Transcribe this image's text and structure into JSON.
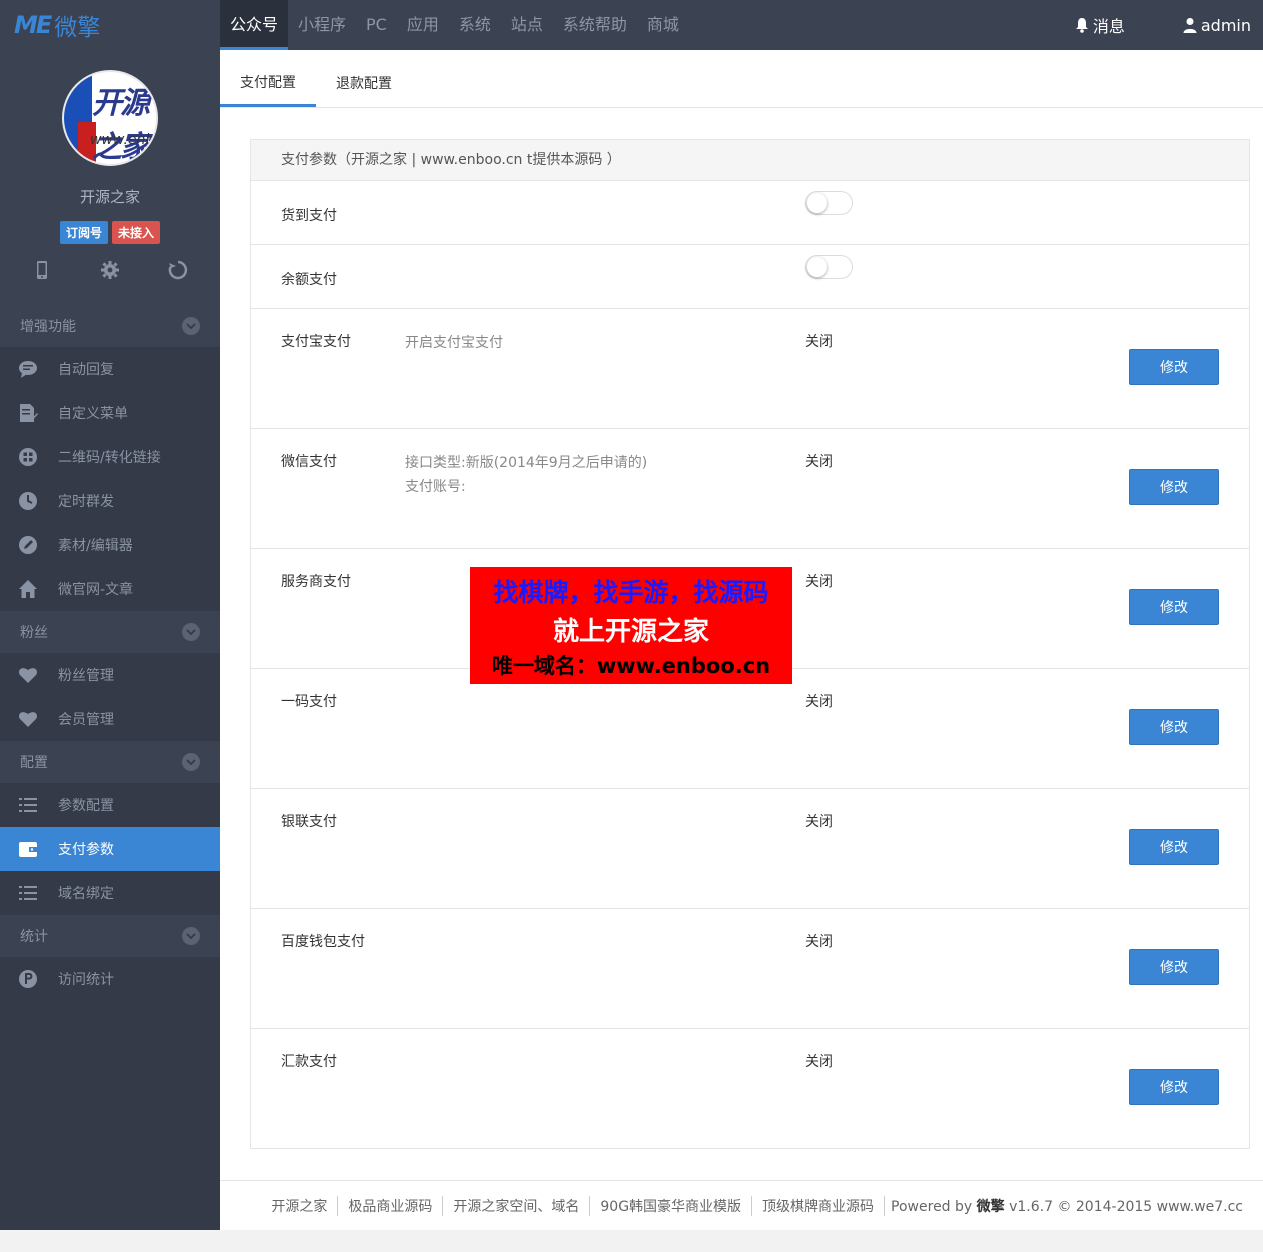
{
  "brand": {
    "logo_me": "ME",
    "logo_text": "微擎"
  },
  "top_nav": [
    "公众号",
    "小程序",
    "PC",
    "应用",
    "系统",
    "站点",
    "系统帮助",
    "商城"
  ],
  "top_right": {
    "messages": "消息",
    "user": "admin"
  },
  "profile": {
    "avatar_text": "开源之家",
    "avatar_url_text": "www.enboo",
    "name": "开源之家",
    "badge_type": "订阅号",
    "badge_status": "未接入"
  },
  "sidebar": {
    "groups": [
      {
        "title": "增强功能",
        "items": [
          "自动回复",
          "自定义菜单",
          "二维码/转化链接",
          "定时群发",
          "素材/编辑器",
          "微官网-文章"
        ]
      },
      {
        "title": "粉丝",
        "items": [
          "粉丝管理",
          "会员管理"
        ]
      },
      {
        "title": "配置",
        "items": [
          "参数配置",
          "支付参数",
          "域名绑定"
        ]
      },
      {
        "title": "统计",
        "items": [
          "访问统计"
        ]
      }
    ],
    "active": "支付参数"
  },
  "tabs": [
    "支付配置",
    "退款配置"
  ],
  "panel": {
    "title": "支付参数（开源之家 | www.enboo.cn t提供本源码 ）",
    "toggles": [
      {
        "label": "货到支付",
        "enabled": false
      },
      {
        "label": "余额支付",
        "enabled": false
      }
    ],
    "methods": [
      {
        "label": "支付宝支付",
        "desc1": "开启支付宝支付",
        "desc2": "",
        "status": "关闭",
        "button": "修改"
      },
      {
        "label": "微信支付",
        "desc1": "接口类型:新版(2014年9月之后申请的)",
        "desc2": "支付账号:",
        "status": "关闭",
        "button": "修改"
      },
      {
        "label": "服务商支付",
        "desc1": "",
        "desc2": "",
        "status": "关闭",
        "button": "修改"
      },
      {
        "label": "一码支付",
        "desc1": "",
        "desc2": "",
        "status": "关闭",
        "button": "修改"
      },
      {
        "label": "银联支付",
        "desc1": "",
        "desc2": "",
        "status": "关闭",
        "button": "修改"
      },
      {
        "label": "百度钱包支付",
        "desc1": "",
        "desc2": "",
        "status": "关闭",
        "button": "修改"
      },
      {
        "label": "汇款支付",
        "desc1": "",
        "desc2": "",
        "status": "关闭",
        "button": "修改"
      }
    ]
  },
  "ad": {
    "line1": "找棋牌，找手游，找源码",
    "line2": "就上开源之家",
    "line3": "唯一域名：www.enboo.cn"
  },
  "footer": {
    "links": [
      "开源之家",
      "极品商业源码",
      "开源之家空间、域名",
      "90G韩国豪华商业模版",
      "顶级棋牌商业源码"
    ],
    "powered_prefix": "Powered by ",
    "powered_brand": "微擎",
    "powered_suffix": " v1.6.7 © 2014-2015 www.we7.cc"
  },
  "colors": {
    "accent": "#3a86d4",
    "topbar": "#3b4252",
    "sidebar": "#343a48",
    "badge_red": "#d9534f"
  }
}
